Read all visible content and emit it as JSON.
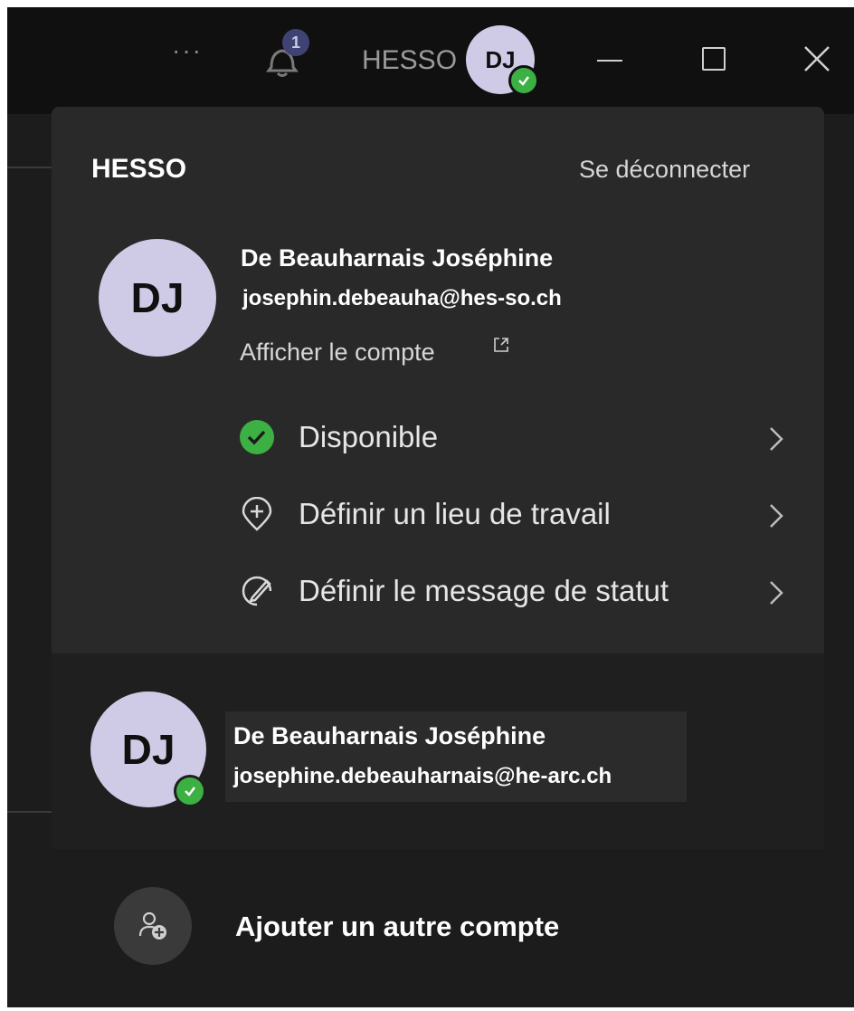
{
  "titlebar": {
    "more_label": "···",
    "notification_count": "1",
    "org_label": "HESSO",
    "avatar_initials": "DJ"
  },
  "panel": {
    "org_title": "HESSO",
    "signout_label": "Se déconnecter",
    "avatar_initials": "DJ",
    "user_name": "De Beauharnais Joséphine",
    "user_email": "josephin.debeauha@hes-so.ch",
    "view_account_label": "Afficher le compte",
    "menu": [
      {
        "label": "Disponible",
        "icon": "available-check-icon"
      },
      {
        "label": "Définir un lieu de travail",
        "icon": "location-pin-plus-icon"
      },
      {
        "label": "Définir le message de statut",
        "icon": "status-message-pen-icon"
      }
    ]
  },
  "other_account": {
    "avatar_initials": "DJ",
    "name": "De Beauharnais Joséphine",
    "email": "josephine.debeauharnais@he-arc.ch"
  },
  "add_account": {
    "label": "Ajouter un autre compte"
  },
  "colors": {
    "status_green": "#3cb043",
    "avatar_bg": "#cfcbe6",
    "panel_bg": "#292929"
  }
}
